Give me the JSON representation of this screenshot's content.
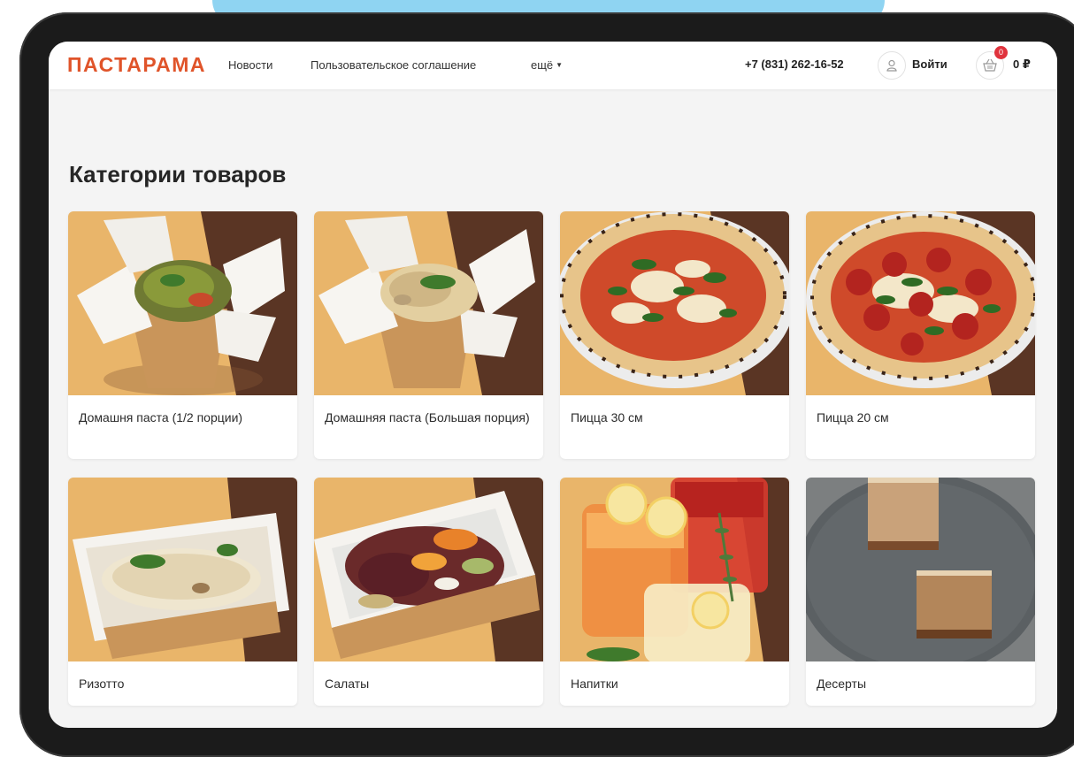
{
  "site": {
    "logo": "ПАСТАРАМА"
  },
  "nav": {
    "links": [
      "Новости",
      "Пользовательское соглашение",
      "ещё"
    ],
    "phone": "+7 (831) 262-16-52",
    "login_label": "Войти",
    "cart_count": "0",
    "cart_total": "0 ₽"
  },
  "icons": {
    "user": "user-icon",
    "cart": "basket-icon",
    "more": "caret-down-icon"
  },
  "colors": {
    "brand": "#e0542a",
    "badge": "#e0333d"
  },
  "page": {
    "title": "Категории товаров"
  },
  "categories": [
    {
      "label": "Домашня паста (1/2 порции)",
      "image": "pasta-box-small"
    },
    {
      "label": "Домашняя паста (Большая порция)",
      "image": "pasta-box-large"
    },
    {
      "label": "Пицца 30 см",
      "image": "pizza-margherita"
    },
    {
      "label": "Пицца 20 см",
      "image": "pizza-pepperoni"
    },
    {
      "label": "Ризотто",
      "image": "risotto-box"
    },
    {
      "label": "Салаты",
      "image": "salad-box"
    },
    {
      "label": "Напитки",
      "image": "drinks"
    },
    {
      "label": "Десерты",
      "image": "tiramisu"
    }
  ]
}
